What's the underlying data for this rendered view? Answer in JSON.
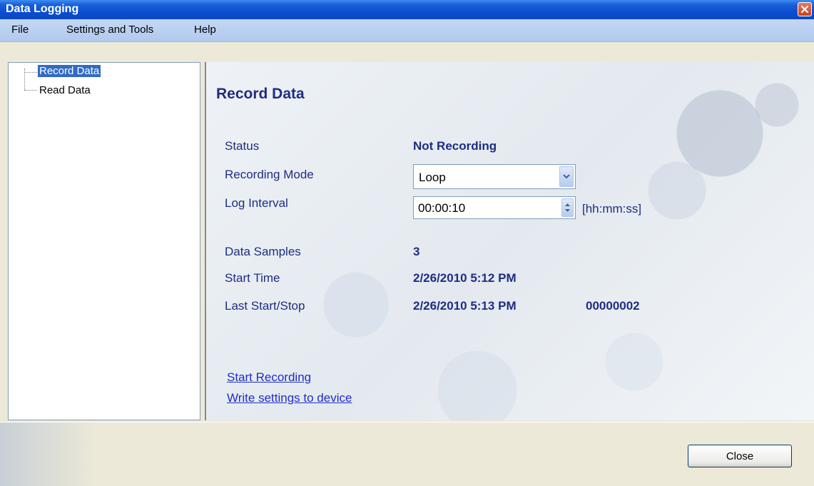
{
  "window": {
    "title": "Data Logging"
  },
  "menu": {
    "file": "File",
    "settings": "Settings and Tools",
    "help": "Help"
  },
  "tree": {
    "items": [
      "Record Data",
      "Read Data"
    ]
  },
  "panel": {
    "title": "Record Data",
    "status_label": "Status",
    "status_value": "Not Recording",
    "mode_label": "Recording Mode",
    "mode_value": "Loop",
    "interval_label": "Log Interval",
    "interval_value": "00:00:10",
    "interval_unit": "[hh:mm:ss]",
    "samples_label": "Data Samples",
    "samples_value": "3",
    "start_label": "Start Time",
    "start_value": "2/26/2010 5:12 PM",
    "last_label": "Last Start/Stop",
    "last_value": "2/26/2010 5:13 PM",
    "last_code": "00000002",
    "link_start": "Start Recording",
    "link_write": "Write settings to device"
  },
  "footer": {
    "close": "Close"
  },
  "icons": {
    "window_close": "close-icon",
    "dropdown": "chevron-down-icon",
    "spinner": "spinner-arrows-icon"
  },
  "colors": {
    "accent": "#1f2d80",
    "link": "#1f2dcc",
    "selection": "#316ac5"
  }
}
